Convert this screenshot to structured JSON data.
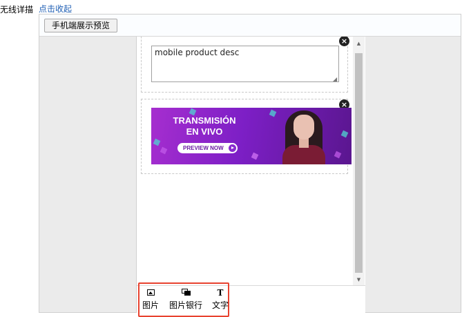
{
  "form": {
    "field_label": "无线详描",
    "collapse_link": "点击收起"
  },
  "toolbar": {
    "preview_button": "手机端展示预览"
  },
  "modules": {
    "text_module": {
      "content": "mobile product desc",
      "close_icon": "×"
    },
    "image_module": {
      "close_icon": "×",
      "banner": {
        "title": "TRANSMISIÓN EN VIVO",
        "button_label": "PREVIEW NOW"
      }
    }
  },
  "bottom_tools": {
    "items": [
      {
        "label": "图片",
        "icon": "image-icon"
      },
      {
        "label": "图片银行",
        "icon": "image-bank-icon"
      },
      {
        "label": "文字",
        "icon": "text-icon",
        "glyph": "T"
      }
    ],
    "highlight_color": "#e8422f"
  },
  "colors": {
    "link": "#1f5fb4",
    "banner_gradient_start": "#a62ecf",
    "banner_gradient_end": "#5a168f"
  }
}
